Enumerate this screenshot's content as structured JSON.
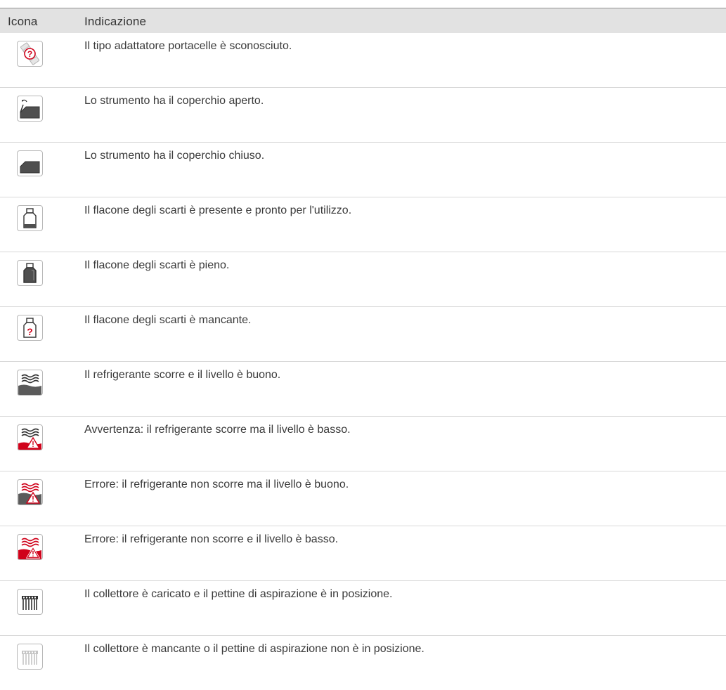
{
  "header": {
    "icon_col": "Icona",
    "indication_col": "Indicazione"
  },
  "rows": [
    {
      "icon": "unknown-adapter-icon",
      "text": "Il tipo adattatore portacelle è sconosciuto."
    },
    {
      "icon": "lid-open-icon",
      "text": "Lo strumento ha il coperchio aperto."
    },
    {
      "icon": "lid-closed-icon",
      "text": "Lo strumento ha il coperchio chiuso."
    },
    {
      "icon": "waste-bottle-ready-icon",
      "text": "Il flacone degli scarti è presente e pronto per l'utilizzo."
    },
    {
      "icon": "waste-bottle-full-icon",
      "text": "Il flacone degli scarti è pieno."
    },
    {
      "icon": "waste-bottle-missing-icon",
      "text": "Il flacone degli scarti è mancante."
    },
    {
      "icon": "coolant-ok-icon",
      "text": "Il refrigerante scorre e il livello è buono."
    },
    {
      "icon": "coolant-low-warning-icon",
      "text": "Avvertenza: il refrigerante scorre ma il livello è basso."
    },
    {
      "icon": "coolant-no-flow-error-icon",
      "text": "Errore: il refrigerante non scorre ma il livello è buono."
    },
    {
      "icon": "coolant-no-flow-low-error-icon",
      "text": "Errore: il refrigerante non scorre e il livello è basso."
    },
    {
      "icon": "manifold-loaded-icon",
      "text": "Il collettore è caricato e il pettine di aspirazione è in posizione."
    },
    {
      "icon": "manifold-missing-icon",
      "text": "Il collettore è mancante o il pettine di aspirazione non è in posizione."
    }
  ],
  "colors": {
    "warning_red": "#d0021b",
    "icon_gray": "#5a5a5a",
    "header_bg": "#e2e2e2"
  }
}
